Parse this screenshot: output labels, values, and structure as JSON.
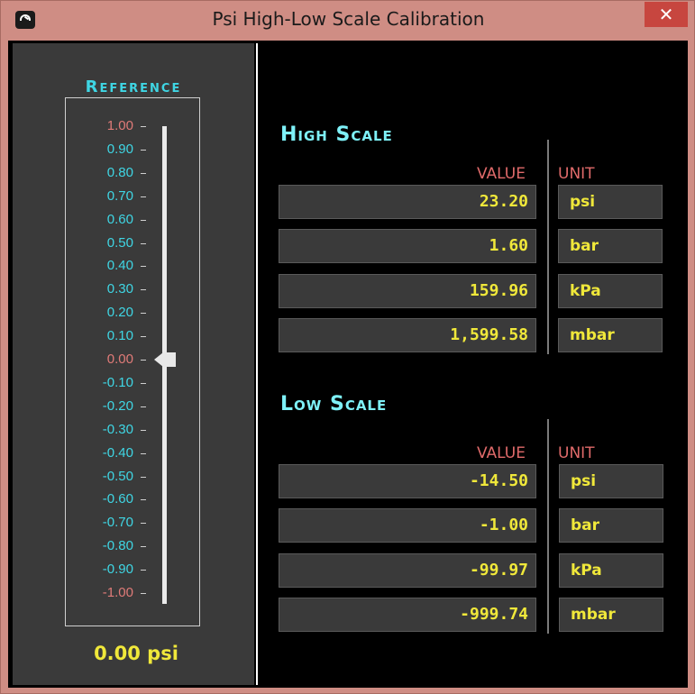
{
  "window": {
    "title": "Psi High-Low Scale Calibration",
    "close_glyph": "✕"
  },
  "reference": {
    "title": "Reference",
    "ticks": [
      "1.00",
      "0.90",
      "0.80",
      "0.70",
      "0.60",
      "0.50",
      "0.40",
      "0.30",
      "0.20",
      "0.10",
      "0.00",
      "-0.10",
      "-0.20",
      "-0.30",
      "-0.40",
      "-0.50",
      "-0.60",
      "-0.70",
      "-0.80",
      "-0.90",
      "-1.00"
    ],
    "slider_value": 0.0,
    "readout": "0.00 psi",
    "colors": {
      "tick_normal": "#3fd6e4",
      "tick_highlight": "#e07b78"
    }
  },
  "high_scale": {
    "title": "High Scale",
    "value_header": "VALUE",
    "unit_header": "UNIT",
    "rows": [
      {
        "value": "23.20",
        "unit": "psi"
      },
      {
        "value": "1.60",
        "unit": "bar"
      },
      {
        "value": "159.96",
        "unit": "kPa"
      },
      {
        "value": "1,599.58",
        "unit": "mbar"
      }
    ]
  },
  "low_scale": {
    "title": "Low Scale",
    "value_header": "VALUE",
    "unit_header": "UNIT",
    "rows": [
      {
        "value": "-14.50",
        "unit": "psi"
      },
      {
        "value": "-1.00",
        "unit": "bar"
      },
      {
        "value": "-99.97",
        "unit": "kPa"
      },
      {
        "value": "-999.74",
        "unit": "mbar"
      }
    ]
  }
}
